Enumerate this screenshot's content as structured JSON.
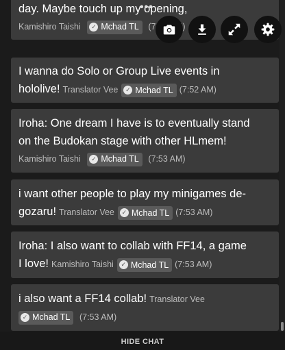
{
  "messages": [
    {
      "line1": "day. Maybe touch up my opening, ",
      "author": "Kamishiro Taishi",
      "badge": "Mchad TL",
      "time": "(7:52 AM)"
    },
    {
      "line1": "I wanna do Solo or Group Live events in",
      "line2": "hololive!",
      "author": "Translator Vee",
      "badge": "Mchad TL",
      "time": "(7:52 AM)"
    },
    {
      "line1": "Iroha: One dream I have is to eventually stand",
      "line2": "on the Budokan stage with other HLmem!",
      "author": "Kamishiro Taishi",
      "badge": "Mchad TL",
      "time": "(7:53 AM)"
    },
    {
      "line1": "i want other people to play my minigames de-",
      "line2": "gozaru!",
      "author": "Translator Vee",
      "badge": "Mchad TL",
      "time": "(7:53 AM)"
    },
    {
      "line1": "Iroha: I also want to collab with FF14, a game",
      "line2": "I love!",
      "author": "Kamishiro Taishi",
      "badge": "Mchad TL",
      "time": "(7:53 AM)"
    },
    {
      "line1": "i also want a FF14 collab!",
      "author": "Translator Vee",
      "badge": "Mchad TL",
      "time": "(7:53 AM)"
    }
  ],
  "controls": {
    "camera": "camera-icon",
    "download": "download-icon",
    "expand": "expand-icon",
    "settings": "gear-icon",
    "drag_handle": "drag-handle-icon"
  },
  "footer": {
    "hide_chat": "HIDE CHAT"
  },
  "colors": {
    "background": "#1b1b1b",
    "message_bg": "#3b3b3b",
    "badge_bg": "#5a5a5a",
    "text": "#ffffff",
    "muted": "#bdbdbd"
  }
}
